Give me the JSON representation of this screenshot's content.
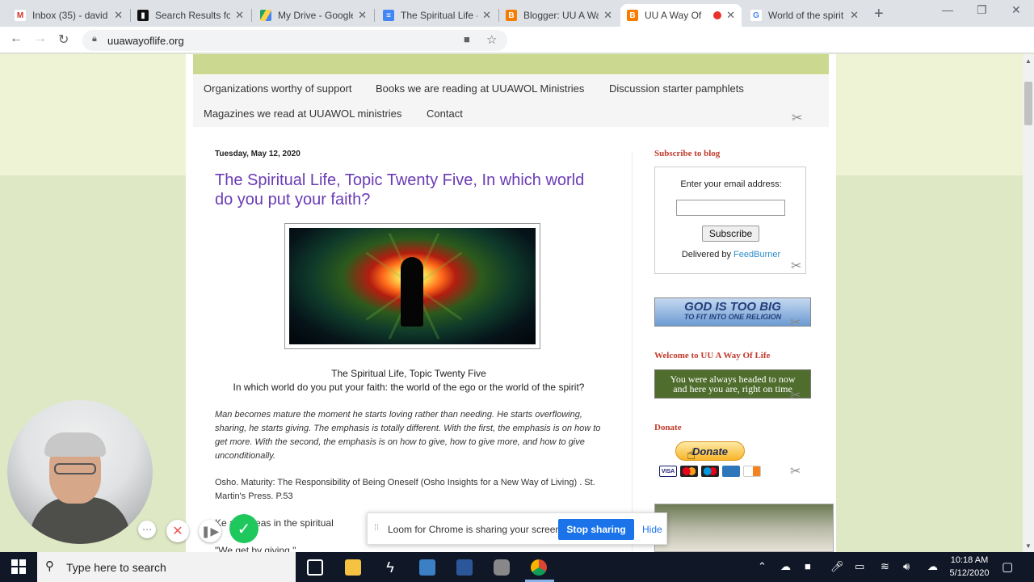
{
  "browser": {
    "tabs": [
      {
        "title": "Inbox (35) - david",
        "favicon": "gmail-icon",
        "color": "#d93025",
        "glyph": "M"
      },
      {
        "title": "Search Results for",
        "favicon": "bars-icon",
        "color": "#111111",
        "glyph": "▮"
      },
      {
        "title": "My Drive - Google",
        "favicon": "drive-icon",
        "color": "#1fa463",
        "glyph": "▲"
      },
      {
        "title": "The Spiritual Life -",
        "favicon": "docs-icon",
        "color": "#4285f4",
        "glyph": "≡"
      },
      {
        "title": "Blogger: UU A Wa",
        "favicon": "blogger-icon",
        "color": "#f57d00",
        "glyph": "B"
      },
      {
        "title": "UU A Way Of",
        "favicon": "blogger-icon",
        "color": "#f57d00",
        "glyph": "B",
        "active": true
      },
      {
        "title": "World of the spirit",
        "favicon": "google-icon",
        "color": "#4285f4",
        "glyph": "G"
      }
    ],
    "new_tab": "+",
    "url": "uuawayoflife.org"
  },
  "blog": {
    "nav": {
      "row1": [
        "Organizations worthy of support",
        "Books we are reading at UUAWOL Ministries",
        "Discussion starter pamphlets"
      ],
      "row2": [
        "Magazines we read at UUAWOL ministries",
        "Contact"
      ]
    },
    "post": {
      "date": "Tuesday, May 12, 2020",
      "title": "The Spiritual Life, Topic Twenty Five, In which world do you put your faith?",
      "caption_line1": "The Spiritual Life, Topic Twenty Five",
      "caption_line2": "In which world do you put your faith: the world of the ego or the world of the spirit?",
      "quote": "Man becomes mature the moment he starts loving rather than needing. He starts overflowing, sharing, he starts giving. The emphasis is totally different. With the first, the emphasis is on how to get more. With the second, the emphasis is on how to give, how to give more, and how to give unconditionally.",
      "citation": "Osho. Maturity: The Responsibility of Being Oneself (Osho Insights for a New Way of Living) . St. Martin's Press. P.53",
      "line_partial": "Ke          any ideas in the spiritual",
      "line_partial2": "\"We get by giving.\""
    },
    "sidebar": {
      "subscribe_heading": "Subscribe to blog",
      "email_label": "Enter your email address:",
      "subscribe_button": "Subscribe",
      "delivered_by": "Delivered by",
      "feedburner": "FeedBurner",
      "banner1_line1": "GOD IS TOO BIG",
      "banner1_line2": "TO FIT INTO ONE RELIGION",
      "welcome_heading": "Welcome to UU A Way Of Life",
      "banner2_line1": "You were always headed to now",
      "banner2_line2": "and here you are, right on time",
      "donate_heading": "Donate",
      "donate_button": "Donate",
      "cards": [
        "visa",
        "mastercard",
        "maestro",
        "amex",
        "discover"
      ]
    }
  },
  "loom": {
    "message": "Loom for Chrome is sharing your screen.",
    "stop": "Stop sharing",
    "hide": "Hide"
  },
  "taskbar": {
    "search_placeholder": "Type here to search",
    "time": "10:18 AM",
    "date": "5/12/2020"
  }
}
